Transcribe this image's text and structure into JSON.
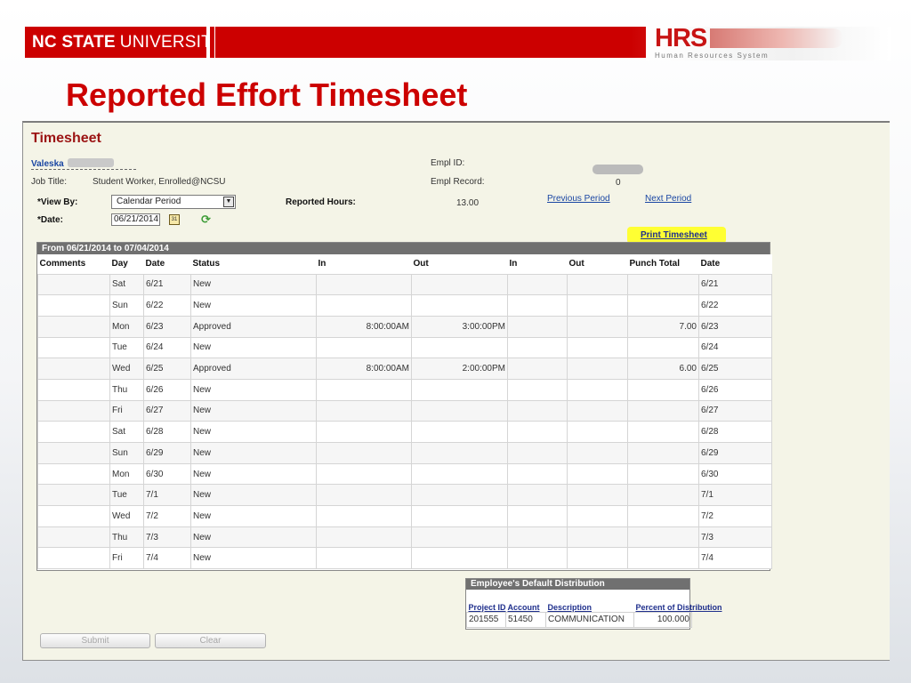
{
  "banner": {
    "univ_bold": "NC STATE",
    "univ_light": "UNIVERSITY",
    "hrs_logo": "HRS",
    "hrs_sub": "Human Resources System"
  },
  "slide_title": "Reported Effort Timesheet",
  "timesheet": {
    "heading": "Timesheet",
    "employee_name": "Valeska",
    "job_title_label": "Job Title:",
    "job_title": "Student Worker, Enrolled@NCSU",
    "empl_id_label": "Empl ID:",
    "empl_record_label": "Empl Record:",
    "empl_record": "0",
    "view_by_label": "*View By:",
    "view_by_value": "Calendar Period",
    "date_label": "*Date:",
    "date_value": "06/21/2014",
    "reported_hours_label": "Reported Hours:",
    "reported_hours": "13.00",
    "previous_period": "Previous Period",
    "next_period": "Next Period",
    "print_timesheet": "Print Timesheet"
  },
  "grid": {
    "period": "From 06/21/2014 to 07/04/2014",
    "columns": [
      "Comments",
      "Day",
      "Date",
      "Status",
      "In",
      "Out",
      "In",
      "Out",
      "Punch Total",
      "Date"
    ],
    "rows": [
      [
        "",
        "Sat",
        "6/21",
        "New",
        "",
        "",
        "",
        "",
        "",
        "6/21"
      ],
      [
        "",
        "Sun",
        "6/22",
        "New",
        "",
        "",
        "",
        "",
        "",
        "6/22"
      ],
      [
        "",
        "Mon",
        "6/23",
        "Approved",
        "8:00:00AM",
        "3:00:00PM",
        "",
        "",
        "7.00",
        "6/23"
      ],
      [
        "",
        "Tue",
        "6/24",
        "New",
        "",
        "",
        "",
        "",
        "",
        "6/24"
      ],
      [
        "",
        "Wed",
        "6/25",
        "Approved",
        "8:00:00AM",
        "2:00:00PM",
        "",
        "",
        "6.00",
        "6/25"
      ],
      [
        "",
        "Thu",
        "6/26",
        "New",
        "",
        "",
        "",
        "",
        "",
        "6/26"
      ],
      [
        "",
        "Fri",
        "6/27",
        "New",
        "",
        "",
        "",
        "",
        "",
        "6/27"
      ],
      [
        "",
        "Sat",
        "6/28",
        "New",
        "",
        "",
        "",
        "",
        "",
        "6/28"
      ],
      [
        "",
        "Sun",
        "6/29",
        "New",
        "",
        "",
        "",
        "",
        "",
        "6/29"
      ],
      [
        "",
        "Mon",
        "6/30",
        "New",
        "",
        "",
        "",
        "",
        "",
        "6/30"
      ],
      [
        "",
        "Tue",
        "7/1",
        "New",
        "",
        "",
        "",
        "",
        "",
        "7/1"
      ],
      [
        "",
        "Wed",
        "7/2",
        "New",
        "",
        "",
        "",
        "",
        "",
        "7/2"
      ],
      [
        "",
        "Thu",
        "7/3",
        "New",
        "",
        "",
        "",
        "",
        "",
        "7/3"
      ],
      [
        "",
        "Fri",
        "7/4",
        "New",
        "",
        "",
        "",
        "",
        "",
        "7/4"
      ]
    ]
  },
  "distribution": {
    "title": "Employee's Default Distribution",
    "columns": [
      "Project ID",
      "Account",
      "Description",
      "Percent of Distribution"
    ],
    "rows": [
      [
        "201555",
        "51450",
        "COMMUNICATION",
        "100.000"
      ]
    ]
  },
  "buttons": {
    "submit": "Submit",
    "clear": "Clear"
  },
  "colors": {
    "brand_red": "#cc0000",
    "panel_bg": "#f4f4e7",
    "link_blue": "#1a46a3",
    "highlight": "#ffff33"
  }
}
